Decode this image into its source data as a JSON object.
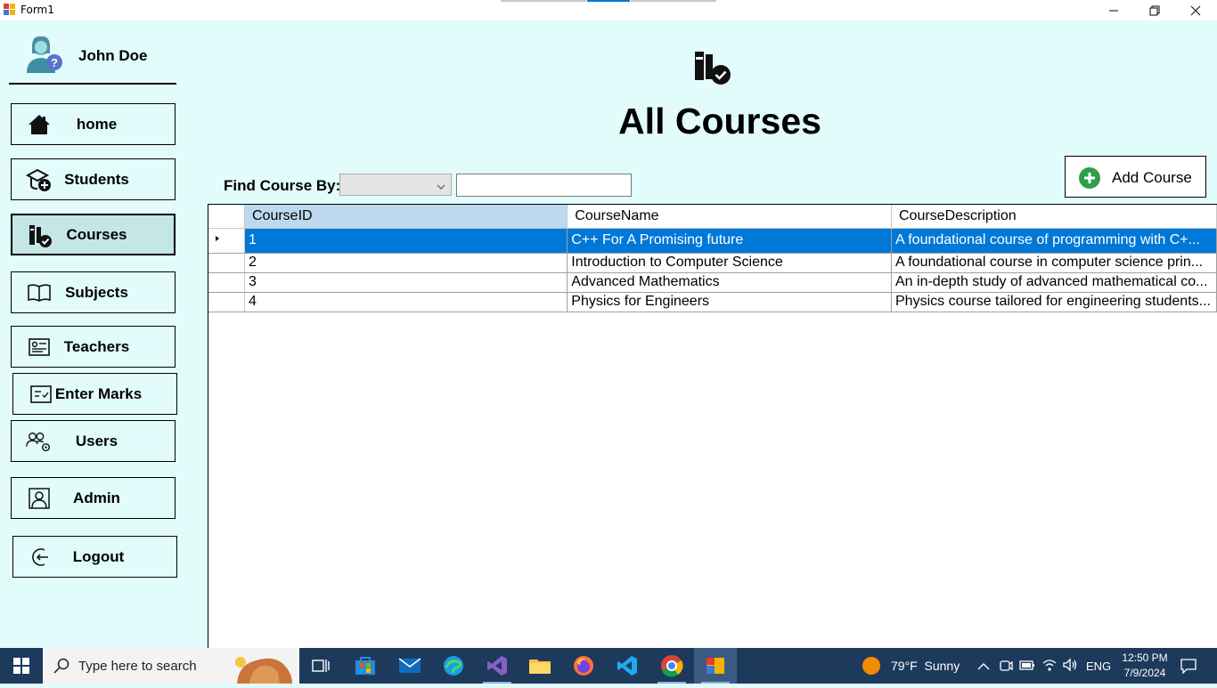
{
  "window": {
    "title": "Form1"
  },
  "user": {
    "name": "John Doe"
  },
  "nav": [
    {
      "label": "home",
      "icon": "home-icon"
    },
    {
      "label": "Students",
      "icon": "students-icon"
    },
    {
      "label": "Courses",
      "icon": "courses-icon",
      "active": true
    },
    {
      "label": "Subjects",
      "icon": "book-icon"
    },
    {
      "label": "Teachers",
      "icon": "teachers-icon"
    },
    {
      "label": "Enter Marks",
      "icon": "marks-icon"
    },
    {
      "label": "Users",
      "icon": "users-gear-icon"
    },
    {
      "label": "Admin",
      "icon": "admin-icon"
    },
    {
      "label": "Logout",
      "icon": "logout-icon"
    }
  ],
  "main": {
    "title": "All Courses",
    "find_label": "Find Course By:",
    "find_select_value": "",
    "find_input_value": "",
    "add_button_label": "Add Course"
  },
  "grid": {
    "columns": [
      "CourseID",
      "CourseName",
      "CourseDescription"
    ],
    "rows": [
      {
        "id": "1",
        "name": "C++ For A Promising future",
        "desc": "A foundational course of programming with C+...",
        "selected": true
      },
      {
        "id": "2",
        "name": "Introduction to Computer Science",
        "desc": "A foundational course in computer science prin..."
      },
      {
        "id": "3",
        "name": "Advanced Mathematics",
        "desc": "An in-depth study of advanced mathematical co..."
      },
      {
        "id": "4",
        "name": "Physics for Engineers",
        "desc": "Physics course tailored for engineering students..."
      }
    ]
  },
  "taskbar": {
    "search_placeholder": "Type here to search",
    "weather": "79°F  Sunny",
    "language": "ENG",
    "time": "12:50 PM",
    "date": "7/9/2024"
  },
  "colors": {
    "accent": "#0078d7",
    "background": "#e2fcfc",
    "taskbar": "#1d3a5c",
    "header_selected": "#bcd9ef"
  }
}
